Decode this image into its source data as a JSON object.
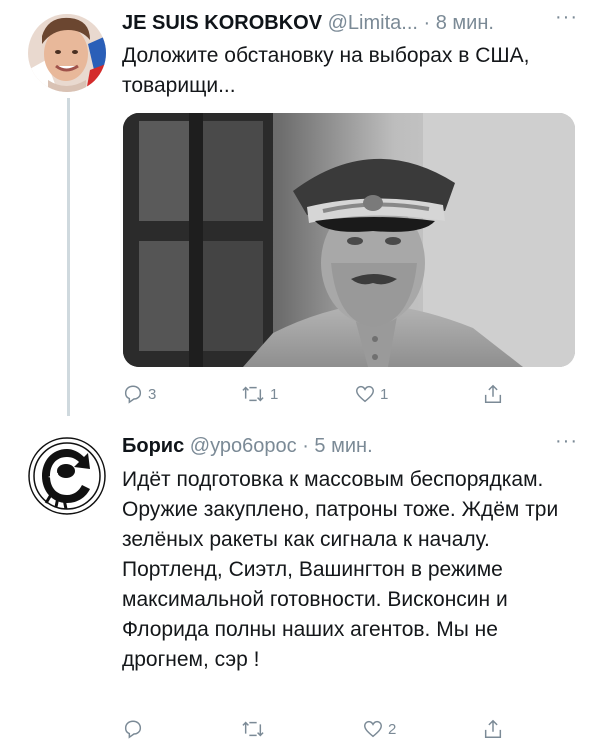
{
  "tweets": [
    {
      "name": "JE SUIS KOROBKOV",
      "handle": "@Limita...",
      "separator": "·",
      "time": "8 мин.",
      "more": "···",
      "text": "Доложите обстановку на выборах в США, товарищи...",
      "has_photo": true,
      "actions": {
        "reply": "3",
        "retweet": "1",
        "like": "1",
        "share": ""
      }
    },
    {
      "name": "Борис",
      "handle": "@уро6орос",
      "separator": "·",
      "time": "5 мин.",
      "more": "···",
      "text": "Идёт подготовка к массовым беспорядкам. Оружие закуплено, патроны тоже. Ждём три зелёных ракеты как сигнала к началу. Портленд, Сиэтл, Вашингтон в режиме максимальной готовности. Висконсин и Флорида полны наших агентов. Мы не дрогнем, сэр !",
      "actions": {
        "reply": "",
        "retweet": "",
        "like": "2",
        "share": ""
      }
    }
  ],
  "icons": {
    "reply": "reply-icon",
    "retweet": "retweet-icon",
    "like": "heart-icon",
    "share": "share-icon",
    "more": "more-options-icon"
  },
  "colors": {
    "meta_gray": "#7b8a96",
    "thread_line": "#cfd9de",
    "text": "#14171a"
  }
}
